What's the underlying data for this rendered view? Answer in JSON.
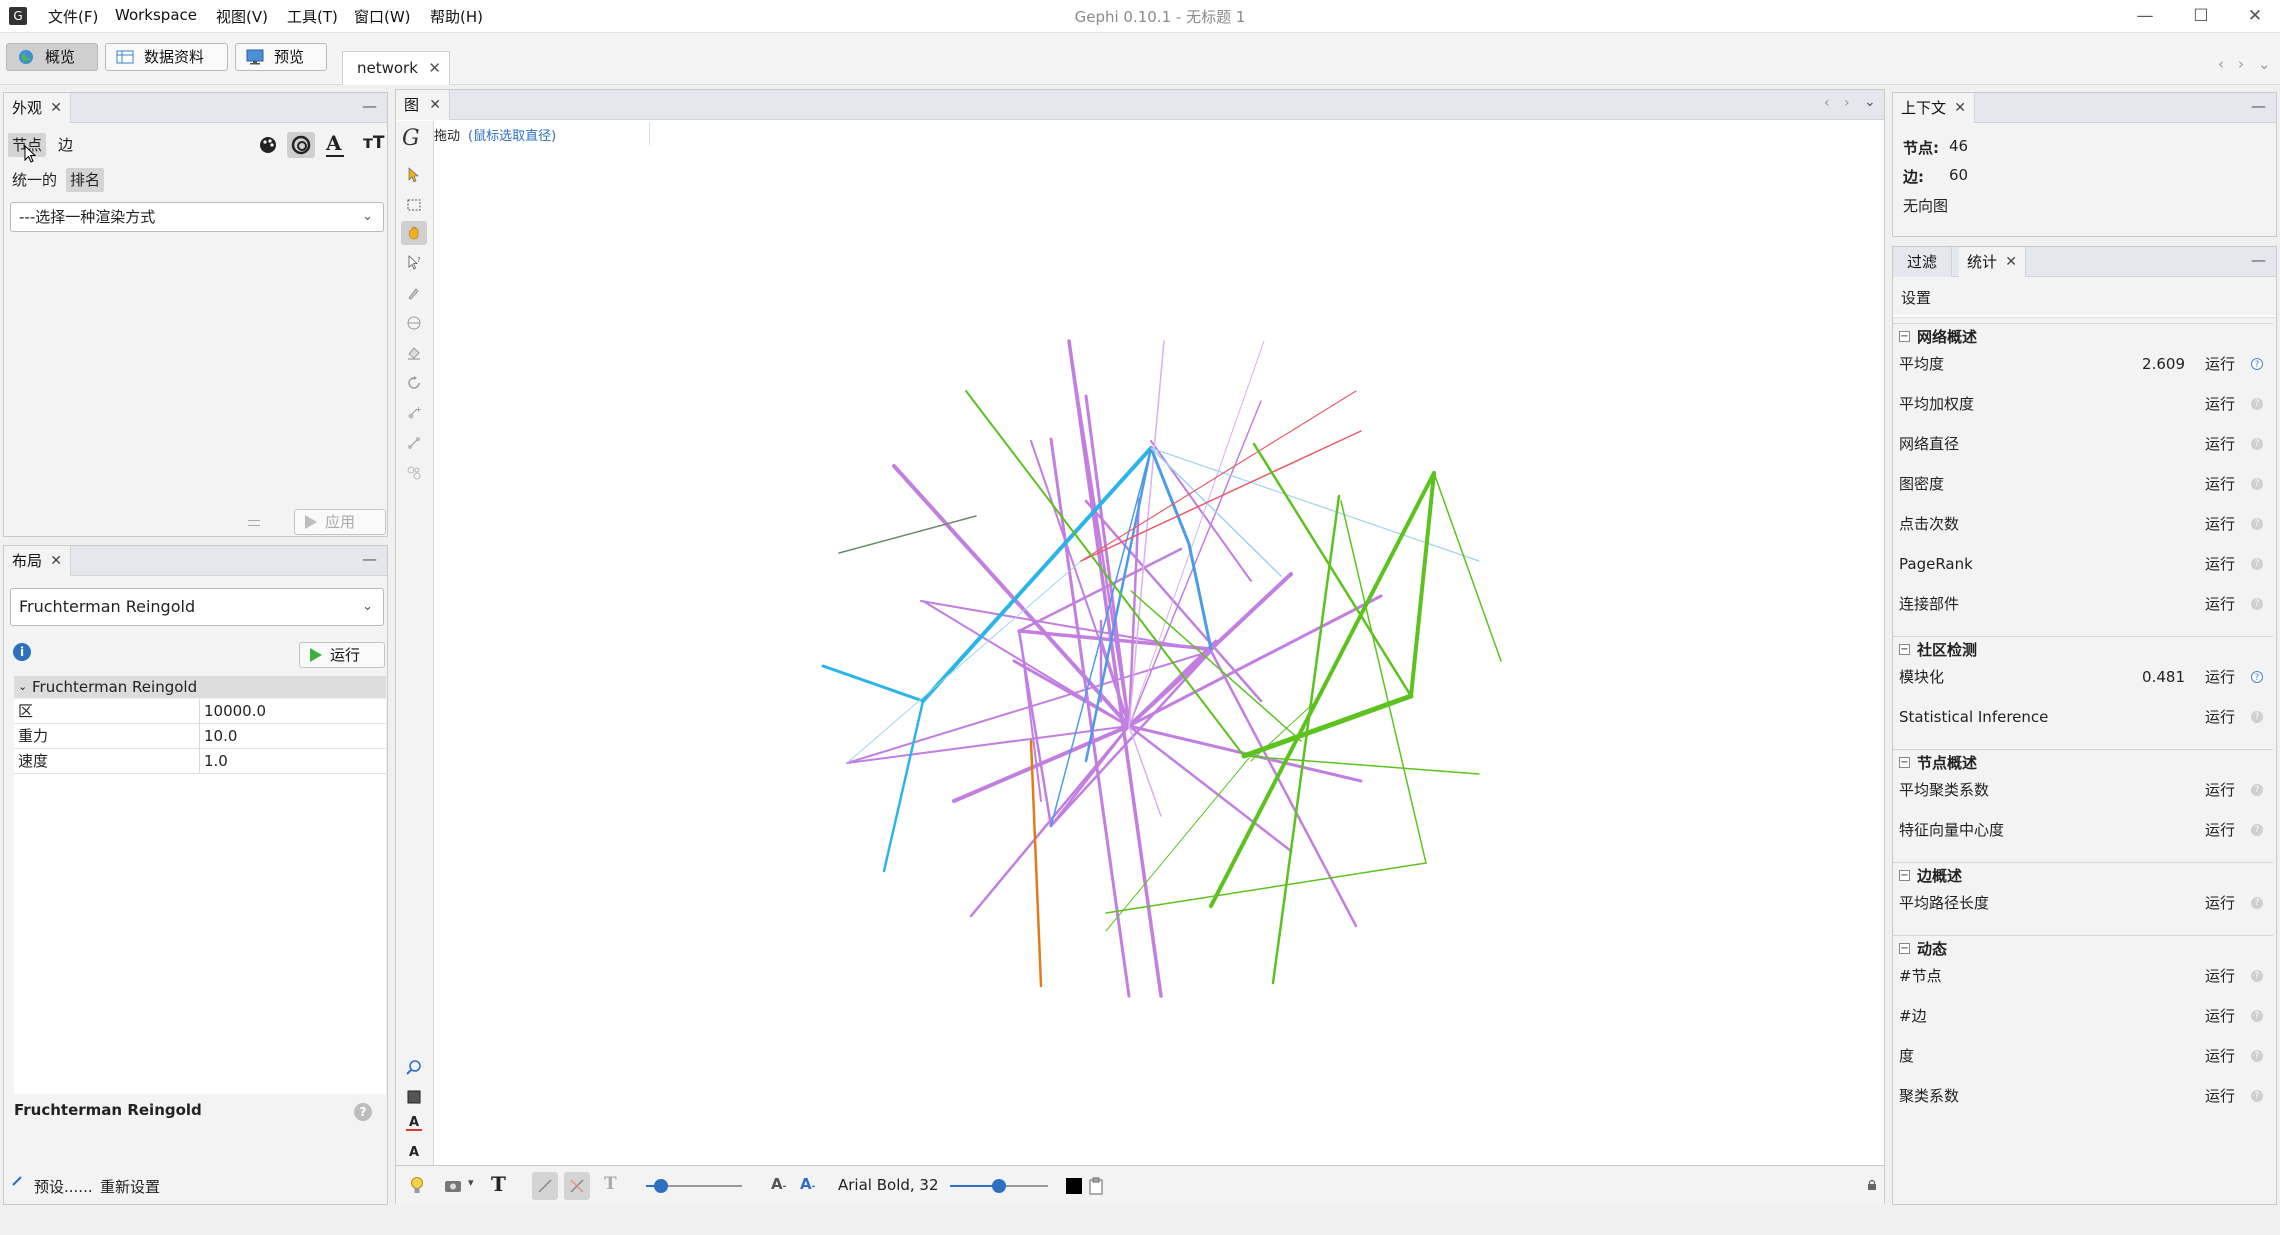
{
  "window": {
    "title": "Gephi 0.10.1 - 无标题 1",
    "menu": [
      "文件(F)",
      "Workspace",
      "视图(V)",
      "工具(T)",
      "窗口(W)",
      "帮助(H)"
    ],
    "controls": {
      "minimize": "—",
      "maximize": "☐",
      "close": "✕"
    }
  },
  "toolbar": {
    "modes": [
      {
        "label": "概览",
        "icon": "globe-icon"
      },
      {
        "label": "数据资料",
        "icon": "table-icon"
      },
      {
        "label": "预览",
        "icon": "monitor-icon"
      }
    ],
    "document_tab": "network"
  },
  "appearance": {
    "tab": "外观",
    "subtabs": [
      "节点",
      "边"
    ],
    "modes": [
      "统一的",
      "排名"
    ],
    "renderer_select": "---选择一种渲染方式",
    "apply_label": "应用"
  },
  "layout": {
    "tab": "布局",
    "algorithm_select": "Fruchterman Reingold",
    "run_label": "运行",
    "group_title": "Fruchterman Reingold",
    "properties": [
      {
        "key": "区",
        "value": "10000.0"
      },
      {
        "key": "重力",
        "value": "10.0"
      },
      {
        "key": "速度",
        "value": "1.0"
      }
    ],
    "description_title": "Fruchterman Reingold",
    "presets_label": "预设......",
    "reset_label": "重新设置"
  },
  "graph": {
    "tab": "图",
    "tool_label": "拖动",
    "tool_hint": "(鼠标选取直径)",
    "font_label": "Arial Bold, 32",
    "colors": {
      "purple": "#c27ee0",
      "blue": "#2bb4e8",
      "green": "#5cc21e",
      "orange": "#e07b1a",
      "red": "#e85a6a",
      "gray": "#6a8a6a",
      "lightpurple": "#d9b0ec",
      "lightblue": "#9ed3f0",
      "steelblue": "#4a9be8"
    }
  },
  "context": {
    "tab": "上下文",
    "nodes_label": "节点:",
    "nodes_value": "46",
    "edges_label": "边:",
    "edges_value": "60",
    "graph_type": "无向图"
  },
  "statistics": {
    "tabs": [
      "过滤",
      "统计"
    ],
    "settings_label": "设置",
    "sections": [
      {
        "title": "网络概述",
        "items": [
          {
            "name": "平均度",
            "value": "2.609",
            "run": "运行",
            "done": true
          },
          {
            "name": "平均加权度",
            "value": "",
            "run": "运行",
            "done": false
          },
          {
            "name": "网络直径",
            "value": "",
            "run": "运行",
            "done": false
          },
          {
            "name": "图密度",
            "value": "",
            "run": "运行",
            "done": false
          },
          {
            "name": "点击次数",
            "value": "",
            "run": "运行",
            "done": false
          },
          {
            "name": "PageRank",
            "value": "",
            "run": "运行",
            "done": false
          },
          {
            "name": "连接部件",
            "value": "",
            "run": "运行",
            "done": false
          }
        ]
      },
      {
        "title": "社区检测",
        "items": [
          {
            "name": "模块化",
            "value": "0.481",
            "run": "运行",
            "done": true
          },
          {
            "name": "Statistical Inference",
            "value": "",
            "run": "运行",
            "done": false
          }
        ]
      },
      {
        "title": "节点概述",
        "items": [
          {
            "name": "平均聚类系数",
            "value": "",
            "run": "运行",
            "done": false
          },
          {
            "name": "特征向量中心度",
            "value": "",
            "run": "运行",
            "done": false
          }
        ]
      },
      {
        "title": "边概述",
        "items": [
          {
            "name": "平均路径长度",
            "value": "",
            "run": "运行",
            "done": false
          }
        ]
      },
      {
        "title": "动态",
        "items": [
          {
            "name": "#节点",
            "value": "",
            "run": "运行",
            "done": false
          },
          {
            "name": "#边",
            "value": "",
            "run": "运行",
            "done": false
          },
          {
            "name": "度",
            "value": "",
            "run": "运行",
            "done": false
          },
          {
            "name": "聚类系数",
            "value": "",
            "run": "运行",
            "done": false
          }
        ]
      }
    ]
  }
}
